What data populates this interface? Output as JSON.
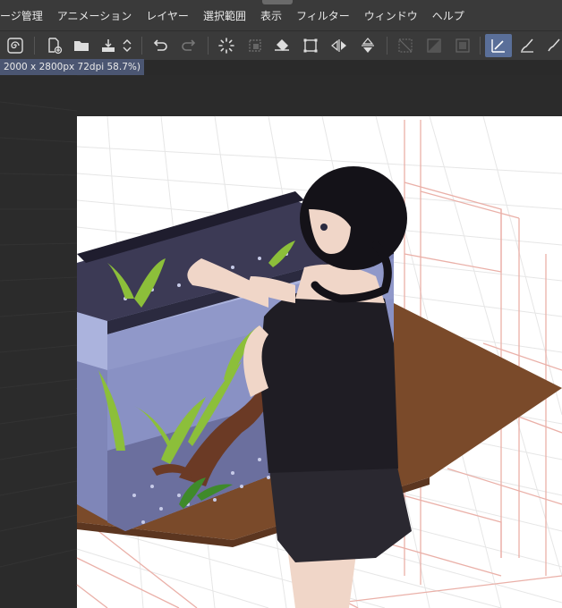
{
  "menu": {
    "items": [
      "ージ管理",
      "アニメーション",
      "レイヤー",
      "選択範囲",
      "表示",
      "フィルター",
      "ウィンドウ",
      "ヘルプ"
    ]
  },
  "toolbar": {
    "icons": [
      "spiral-icon",
      "new-file-icon",
      "open-folder-icon",
      "save-icon",
      "chevron-updown-icon",
      "undo-icon",
      "redo-icon",
      "loading-icon",
      "transform-icon",
      "fill-icon",
      "crop-icon",
      "flip-horizontal-icon",
      "flip-vertical-icon",
      "selection-mask-icon",
      "invert-selection-icon",
      "frame-icon",
      "ruler-pen-icon",
      "brush-icon",
      "brush-alt-icon"
    ]
  },
  "status": {
    "canvas_info": "2000 x 2800px 72dpi 58.7%)"
  },
  "colors": {
    "ui_bg": "#3a3a3a",
    "accent": "#5a6f99",
    "canvas_bg": "#ffffff",
    "guide_line": "#e8a5a0",
    "desk": "#7a4a2a",
    "water": "#8a94c8"
  }
}
